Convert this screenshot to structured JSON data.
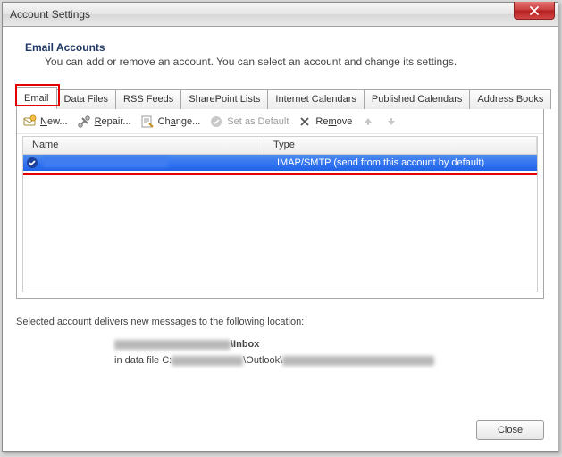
{
  "window": {
    "title": "Account Settings"
  },
  "header": {
    "heading": "Email Accounts",
    "subheading": "You can add or remove an account. You can select an account and change its settings."
  },
  "tabs": [
    {
      "label": "Email",
      "active": true
    },
    {
      "label": "Data Files"
    },
    {
      "label": "RSS Feeds"
    },
    {
      "label": "SharePoint Lists"
    },
    {
      "label": "Internet Calendars"
    },
    {
      "label": "Published Calendars"
    },
    {
      "label": "Address Books"
    }
  ],
  "toolbar": {
    "new": "New...",
    "repair": "Repair...",
    "change": "Change...",
    "set_default": "Set as Default",
    "remove": "Remove"
  },
  "list": {
    "columns": {
      "name": "Name",
      "type": "Type"
    },
    "rows": [
      {
        "name": "(redacted)",
        "type": "IMAP/SMTP (send from this account by default)",
        "selected": true,
        "default": true
      }
    ]
  },
  "footer": {
    "intro": "Selected account delivers new messages to the following location:",
    "folder_suffix": "\\Inbox",
    "datafile_prefix": "in data file C:",
    "datafile_mid": "\\Outlook\\"
  },
  "buttons": {
    "close": "Close"
  }
}
